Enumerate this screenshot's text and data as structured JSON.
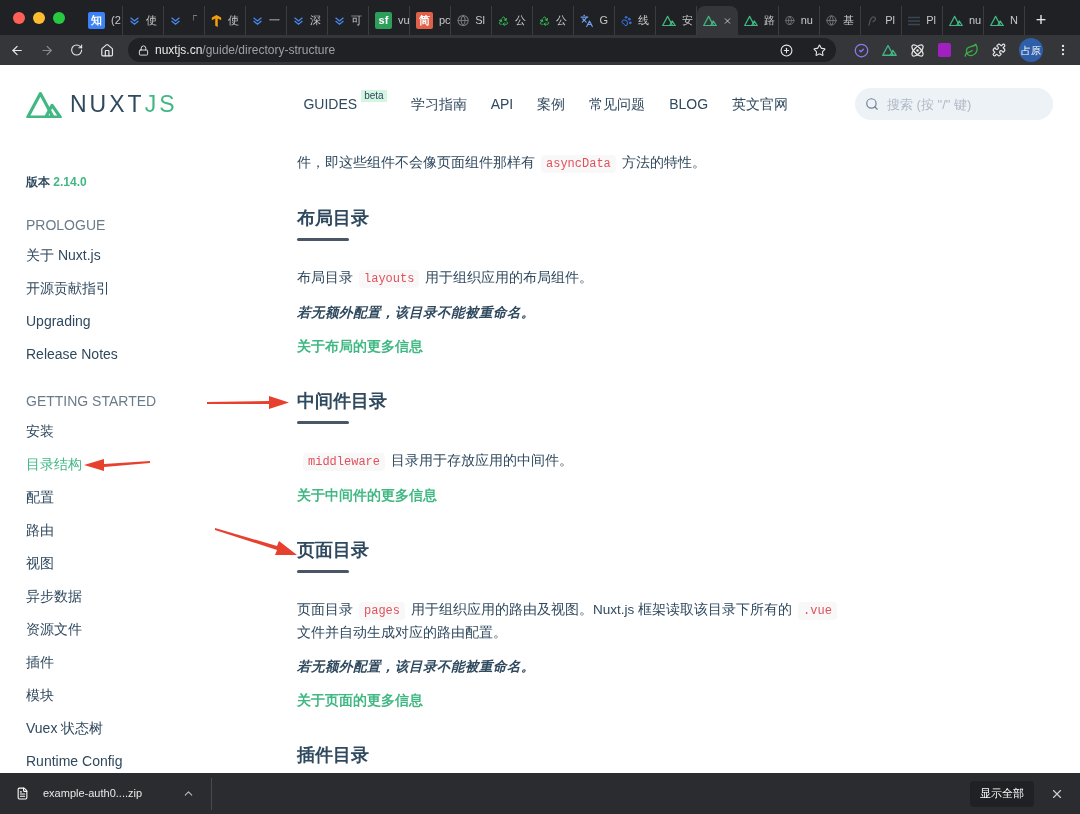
{
  "browser": {
    "tabs": [
      {
        "kind": "badge",
        "badge": "知",
        "color": "#3b82f6",
        "label": "(2",
        "selected": false
      },
      {
        "kind": "chevron",
        "label": "使",
        "selected": false
      },
      {
        "kind": "chevron",
        "label": "「",
        "selected": false
      },
      {
        "kind": "tf",
        "label": "使",
        "selected": false
      },
      {
        "kind": "chevron",
        "label": "一",
        "selected": false
      },
      {
        "kind": "chevron",
        "label": "深",
        "selected": false
      },
      {
        "kind": "chevron",
        "label": "可",
        "selected": false
      },
      {
        "kind": "badge",
        "badge": "sf",
        "color": "#2e9e5b",
        "label": "vu",
        "selected": false
      },
      {
        "kind": "badge",
        "badge": "简",
        "color": "#e0604a",
        "label": "pc",
        "selected": false
      },
      {
        "kind": "globe",
        "label": "Sl",
        "selected": false
      },
      {
        "kind": "recycle",
        "label": "公",
        "selected": false
      },
      {
        "kind": "recycle",
        "label": "公",
        "selected": false
      },
      {
        "kind": "translate",
        "label": "G",
        "selected": false
      },
      {
        "kind": "paw",
        "label": "线",
        "selected": false
      },
      {
        "kind": "nuxt",
        "label": "安",
        "selected": false
      },
      {
        "kind": "nuxt",
        "selected": true
      },
      {
        "kind": "nuxt",
        "label": "路",
        "selected": false
      },
      {
        "kind": "globe",
        "label": "nu",
        "selected": false
      },
      {
        "kind": "globe",
        "label": "基",
        "selected": false
      },
      {
        "kind": "pi",
        "label": "Pl",
        "selected": false
      },
      {
        "kind": "doc",
        "label": "Pl",
        "selected": false
      },
      {
        "kind": "nuxt",
        "label": "nu",
        "selected": false
      },
      {
        "kind": "nuxt",
        "label": "N",
        "selected": false
      }
    ],
    "new_tab": "+",
    "address": {
      "domain": "nuxtjs.cn",
      "path": "/guide/directory-structure"
    },
    "profile": "占原"
  },
  "header": {
    "logo": {
      "main": "NUXT",
      "accent": "JS"
    },
    "nav": [
      {
        "label": "GUIDES",
        "badge": "beta"
      },
      {
        "label": "学习指南"
      },
      {
        "label": "API"
      },
      {
        "label": "案例"
      },
      {
        "label": "常见问题"
      },
      {
        "label": "BLOG"
      },
      {
        "label": "英文官网"
      }
    ],
    "search": {
      "placeholder": "搜索 (按 \"/\" 键)"
    }
  },
  "sidebar": {
    "version_label": "版本",
    "version": "2.14.0",
    "groups": [
      {
        "title": "PROLOGUE",
        "items": [
          {
            "label": "关于 Nuxt.js",
            "selected": false
          },
          {
            "label": "开源贡献指引",
            "selected": false
          },
          {
            "label": "Upgrading",
            "selected": false
          },
          {
            "label": "Release Notes",
            "selected": false
          }
        ]
      },
      {
        "title": "GETTING STARTED",
        "items": [
          {
            "label": "安装",
            "selected": false
          },
          {
            "label": "目录结构",
            "selected": true
          },
          {
            "label": "配置",
            "selected": false
          },
          {
            "label": "路由",
            "selected": false
          },
          {
            "label": "视图",
            "selected": false
          },
          {
            "label": "异步数据",
            "selected": false
          },
          {
            "label": "资源文件",
            "selected": false
          },
          {
            "label": "插件",
            "selected": false
          },
          {
            "label": "模块",
            "selected": false
          },
          {
            "label": "Vuex 状态树",
            "selected": false
          },
          {
            "label": "Runtime Config",
            "selected": false
          }
        ]
      }
    ]
  },
  "content": {
    "intro": [
      {
        "kind": "text",
        "text": "件，即这些组件不会像页面组件那样有"
      },
      {
        "kind": "code",
        "text": "asyncData"
      },
      {
        "kind": "text",
        "text": "方法的特性。"
      }
    ],
    "sections": [
      {
        "heading": "布局目录",
        "blocks": [
          {
            "kind": "para",
            "segments": [
              {
                "kind": "text",
                "text": "布局目录"
              },
              {
                "kind": "code",
                "text": "layouts"
              },
              {
                "kind": "text",
                "text": "用于组织应用的布局组件。"
              }
            ]
          },
          {
            "kind": "note",
            "text": "若无额外配置，该目录不能被重命名。"
          },
          {
            "kind": "link",
            "text": "关于布局的更多信息"
          }
        ]
      },
      {
        "heading": "中间件目录",
        "blocks": [
          {
            "kind": "para",
            "segments": [
              {
                "kind": "code",
                "text": "middleware"
              },
              {
                "kind": "text",
                "text": "目录用于存放应用的中间件。"
              }
            ]
          },
          {
            "kind": "link",
            "text": "关于中间件的更多信息"
          }
        ]
      },
      {
        "heading": "页面目录",
        "blocks": [
          {
            "kind": "para",
            "segments": [
              {
                "kind": "text",
                "text": "页面目录"
              },
              {
                "kind": "code",
                "text": "pages"
              },
              {
                "kind": "text",
                "text": "用于组织应用的路由及视图。Nuxt.js 框架读取该目录下所有的"
              },
              {
                "kind": "code",
                "text": ".vue"
              },
              {
                "kind": "text",
                "text": "文件并自动生成对应的路由配置。"
              }
            ]
          },
          {
            "kind": "note",
            "text": "若无额外配置，该目录不能被重命名。"
          },
          {
            "kind": "link",
            "text": "关于页面的更多信息"
          }
        ]
      },
      {
        "heading": "插件目录"
      }
    ]
  },
  "downloads": {
    "file": "example-auth0....zip",
    "show_all": "显示全部"
  }
}
